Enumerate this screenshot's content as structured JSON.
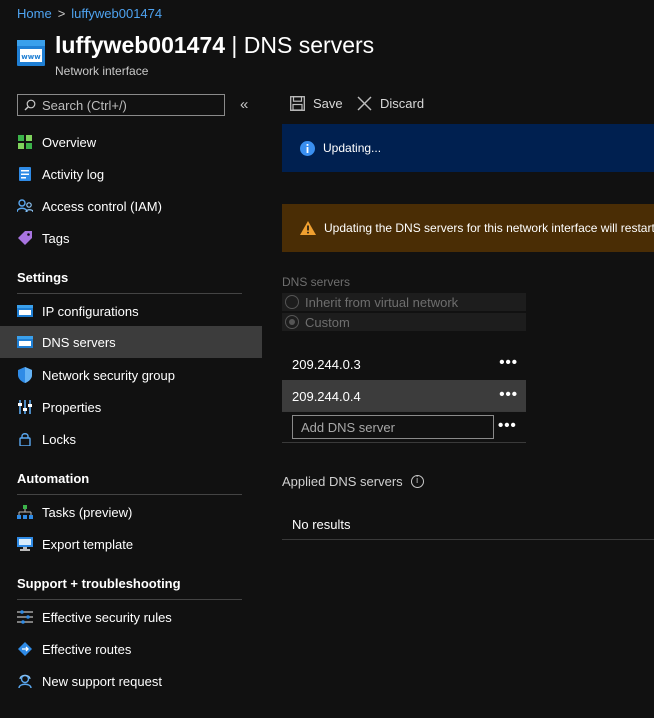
{
  "breadcrumb": {
    "home": "Home",
    "separator": ">",
    "current": "luffyweb001474"
  },
  "header": {
    "resource": "luffyweb001474",
    "title_sep": " | ",
    "page": "DNS servers",
    "subtitle": "Network interface",
    "icon": "network-interface-icon"
  },
  "search": {
    "placeholder": "Search (Ctrl+/)",
    "value": "",
    "collapse_glyph": "«"
  },
  "nav": {
    "top": [
      {
        "label": "Overview",
        "icon": "overview-icon"
      },
      {
        "label": "Activity log",
        "icon": "activity-log-icon"
      },
      {
        "label": "Access control (IAM)",
        "icon": "iam-icon"
      },
      {
        "label": "Tags",
        "icon": "tag-icon"
      }
    ],
    "settings_title": "Settings",
    "settings": [
      {
        "label": "IP configurations",
        "icon": "ip-config-icon"
      },
      {
        "label": "DNS servers",
        "icon": "dns-icon",
        "active": true
      },
      {
        "label": "Network security group",
        "icon": "shield-icon"
      },
      {
        "label": "Properties",
        "icon": "properties-icon"
      },
      {
        "label": "Locks",
        "icon": "lock-icon"
      }
    ],
    "automation_title": "Automation",
    "automation": [
      {
        "label": "Tasks (preview)",
        "icon": "tasks-icon"
      },
      {
        "label": "Export template",
        "icon": "export-template-icon"
      }
    ],
    "support_title": "Support + troubleshooting",
    "support": [
      {
        "label": "Effective security rules",
        "icon": "security-rules-icon"
      },
      {
        "label": "Effective routes",
        "icon": "routes-icon"
      },
      {
        "label": "New support request",
        "icon": "support-icon"
      }
    ]
  },
  "toolbar": {
    "save_label": "Save",
    "discard_label": "Discard"
  },
  "banners": {
    "info": "Updating...",
    "warning": "Updating the DNS servers for this network interface will restart"
  },
  "dns": {
    "label": "DNS servers",
    "options": [
      "Inherit from virtual network",
      "Custom"
    ],
    "selected": "Custom",
    "servers": [
      "209.244.0.3",
      "209.244.0.4"
    ],
    "add_placeholder": "Add DNS server",
    "more_glyph": "•••"
  },
  "applied": {
    "label": "Applied DNS servers",
    "info_glyph": "i",
    "empty": "No results"
  },
  "colors": {
    "link": "#4ea3f0",
    "info_banner": "#002050",
    "warning_banner": "#4a2d05",
    "active_nav": "#3c3c3c"
  }
}
